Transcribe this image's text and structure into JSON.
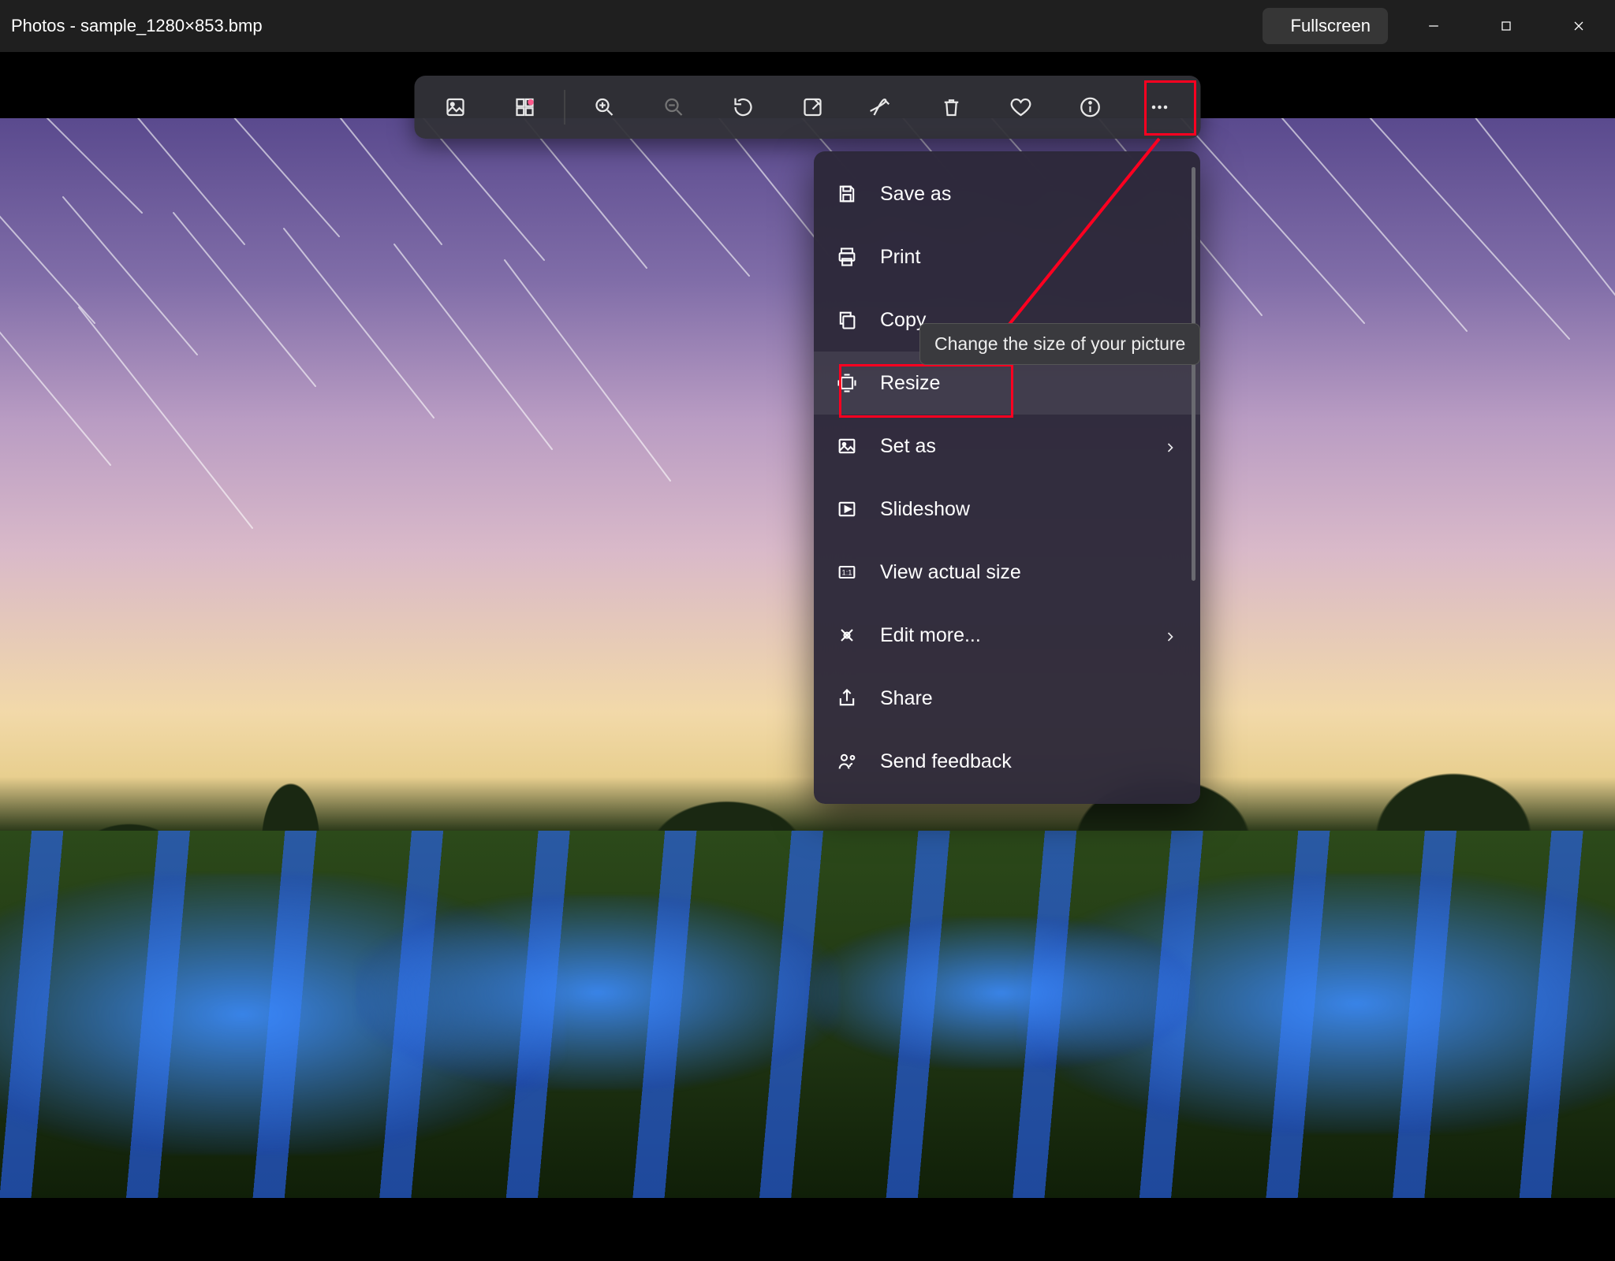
{
  "titlebar": {
    "title": "Photos - sample_1280×853.bmp",
    "fullscreen_label": "Fullscreen"
  },
  "toolbar": {
    "buttons": [
      {
        "name": "image-icon"
      },
      {
        "name": "view-all-icon"
      },
      {
        "name": "separator"
      },
      {
        "name": "zoom-in-icon"
      },
      {
        "name": "zoom-out-icon",
        "disabled": true
      },
      {
        "name": "rotate-icon"
      },
      {
        "name": "edit-image-icon"
      },
      {
        "name": "markup-icon"
      },
      {
        "name": "delete-icon"
      },
      {
        "name": "favorite-icon"
      },
      {
        "name": "info-icon"
      },
      {
        "name": "more-icon"
      }
    ]
  },
  "menu": {
    "items": [
      {
        "icon": "save-icon",
        "label": "Save as"
      },
      {
        "icon": "print-icon",
        "label": "Print"
      },
      {
        "icon": "copy-icon",
        "label": "Copy"
      },
      {
        "icon": "resize-icon",
        "label": "Resize",
        "highlighted": true
      },
      {
        "icon": "set-as-icon",
        "label": "Set as",
        "submenu": true
      },
      {
        "icon": "slideshow-icon",
        "label": "Slideshow"
      },
      {
        "icon": "actual-size-icon",
        "label": "View actual size"
      },
      {
        "icon": "edit-more-icon",
        "label": "Edit more...",
        "submenu": true
      },
      {
        "icon": "share-icon",
        "label": "Share"
      },
      {
        "icon": "feedback-icon",
        "label": "Send feedback"
      }
    ]
  },
  "tooltip": {
    "text": "Change the size of your picture"
  },
  "annotations": {
    "highlight_color": "#ff0020"
  }
}
